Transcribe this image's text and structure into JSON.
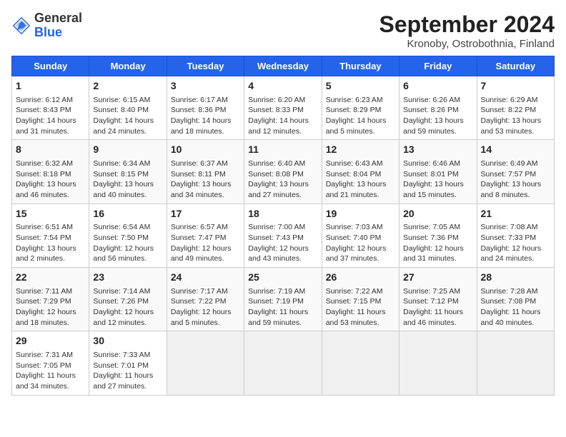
{
  "header": {
    "logo_general": "General",
    "logo_blue": "Blue",
    "title": "September 2024",
    "subtitle": "Kronoby, Ostrobothnia, Finland"
  },
  "days_of_week": [
    "Sunday",
    "Monday",
    "Tuesday",
    "Wednesday",
    "Thursday",
    "Friday",
    "Saturday"
  ],
  "weeks": [
    [
      {
        "day": "1",
        "info": "Sunrise: 6:12 AM\nSunset: 8:43 PM\nDaylight: 14 hours\nand 31 minutes."
      },
      {
        "day": "2",
        "info": "Sunrise: 6:15 AM\nSunset: 8:40 PM\nDaylight: 14 hours\nand 24 minutes."
      },
      {
        "day": "3",
        "info": "Sunrise: 6:17 AM\nSunset: 8:36 PM\nDaylight: 14 hours\nand 18 minutes."
      },
      {
        "day": "4",
        "info": "Sunrise: 6:20 AM\nSunset: 8:33 PM\nDaylight: 14 hours\nand 12 minutes."
      },
      {
        "day": "5",
        "info": "Sunrise: 6:23 AM\nSunset: 8:29 PM\nDaylight: 14 hours\nand 5 minutes."
      },
      {
        "day": "6",
        "info": "Sunrise: 6:26 AM\nSunset: 8:26 PM\nDaylight: 13 hours\nand 59 minutes."
      },
      {
        "day": "7",
        "info": "Sunrise: 6:29 AM\nSunset: 8:22 PM\nDaylight: 13 hours\nand 53 minutes."
      }
    ],
    [
      {
        "day": "8",
        "info": "Sunrise: 6:32 AM\nSunset: 8:18 PM\nDaylight: 13 hours\nand 46 minutes."
      },
      {
        "day": "9",
        "info": "Sunrise: 6:34 AM\nSunset: 8:15 PM\nDaylight: 13 hours\nand 40 minutes."
      },
      {
        "day": "10",
        "info": "Sunrise: 6:37 AM\nSunset: 8:11 PM\nDaylight: 13 hours\nand 34 minutes."
      },
      {
        "day": "11",
        "info": "Sunrise: 6:40 AM\nSunset: 8:08 PM\nDaylight: 13 hours\nand 27 minutes."
      },
      {
        "day": "12",
        "info": "Sunrise: 6:43 AM\nSunset: 8:04 PM\nDaylight: 13 hours\nand 21 minutes."
      },
      {
        "day": "13",
        "info": "Sunrise: 6:46 AM\nSunset: 8:01 PM\nDaylight: 13 hours\nand 15 minutes."
      },
      {
        "day": "14",
        "info": "Sunrise: 6:49 AM\nSunset: 7:57 PM\nDaylight: 13 hours\nand 8 minutes."
      }
    ],
    [
      {
        "day": "15",
        "info": "Sunrise: 6:51 AM\nSunset: 7:54 PM\nDaylight: 13 hours\nand 2 minutes."
      },
      {
        "day": "16",
        "info": "Sunrise: 6:54 AM\nSunset: 7:50 PM\nDaylight: 12 hours\nand 56 minutes."
      },
      {
        "day": "17",
        "info": "Sunrise: 6:57 AM\nSunset: 7:47 PM\nDaylight: 12 hours\nand 49 minutes."
      },
      {
        "day": "18",
        "info": "Sunrise: 7:00 AM\nSunset: 7:43 PM\nDaylight: 12 hours\nand 43 minutes."
      },
      {
        "day": "19",
        "info": "Sunrise: 7:03 AM\nSunset: 7:40 PM\nDaylight: 12 hours\nand 37 minutes."
      },
      {
        "day": "20",
        "info": "Sunrise: 7:05 AM\nSunset: 7:36 PM\nDaylight: 12 hours\nand 31 minutes."
      },
      {
        "day": "21",
        "info": "Sunrise: 7:08 AM\nSunset: 7:33 PM\nDaylight: 12 hours\nand 24 minutes."
      }
    ],
    [
      {
        "day": "22",
        "info": "Sunrise: 7:11 AM\nSunset: 7:29 PM\nDaylight: 12 hours\nand 18 minutes."
      },
      {
        "day": "23",
        "info": "Sunrise: 7:14 AM\nSunset: 7:26 PM\nDaylight: 12 hours\nand 12 minutes."
      },
      {
        "day": "24",
        "info": "Sunrise: 7:17 AM\nSunset: 7:22 PM\nDaylight: 12 hours\nand 5 minutes."
      },
      {
        "day": "25",
        "info": "Sunrise: 7:19 AM\nSunset: 7:19 PM\nDaylight: 11 hours\nand 59 minutes."
      },
      {
        "day": "26",
        "info": "Sunrise: 7:22 AM\nSunset: 7:15 PM\nDaylight: 11 hours\nand 53 minutes."
      },
      {
        "day": "27",
        "info": "Sunrise: 7:25 AM\nSunset: 7:12 PM\nDaylight: 11 hours\nand 46 minutes."
      },
      {
        "day": "28",
        "info": "Sunrise: 7:28 AM\nSunset: 7:08 PM\nDaylight: 11 hours\nand 40 minutes."
      }
    ],
    [
      {
        "day": "29",
        "info": "Sunrise: 7:31 AM\nSunset: 7:05 PM\nDaylight: 11 hours\nand 34 minutes."
      },
      {
        "day": "30",
        "info": "Sunrise: 7:33 AM\nSunset: 7:01 PM\nDaylight: 11 hours\nand 27 minutes."
      },
      {
        "day": "",
        "info": ""
      },
      {
        "day": "",
        "info": ""
      },
      {
        "day": "",
        "info": ""
      },
      {
        "day": "",
        "info": ""
      },
      {
        "day": "",
        "info": ""
      }
    ]
  ]
}
